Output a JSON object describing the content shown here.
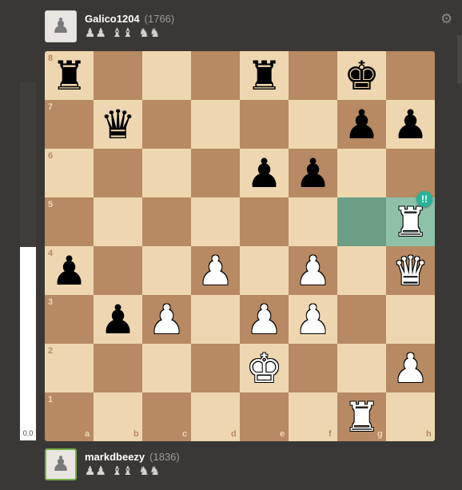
{
  "top_player": {
    "name": "Galico1204",
    "rating": "(1766)",
    "captured": [
      "♟♟",
      "♝♝",
      "♞♞"
    ]
  },
  "bottom_player": {
    "name": "markdbeezy",
    "rating": "(1836)",
    "captured": [
      "♟♟",
      "♝♝",
      "♞♞"
    ]
  },
  "eval": {
    "score": "0.0",
    "white_fraction": 0.54
  },
  "board": {
    "files": [
      "a",
      "b",
      "c",
      "d",
      "e",
      "f",
      "g",
      "h"
    ],
    "ranks": [
      "8",
      "7",
      "6",
      "5",
      "4",
      "3",
      "2",
      "1"
    ],
    "highlights": [
      "g5",
      "h5"
    ],
    "move_badge": {
      "square": "h5",
      "text": "!!",
      "color": "#27b39a"
    },
    "pieces": [
      {
        "sq": "a8",
        "type": "rook",
        "color": "b",
        "glyph": "♜",
        "name": "black-rook-a8"
      },
      {
        "sq": "e8",
        "type": "rook",
        "color": "b",
        "glyph": "♜",
        "name": "black-rook-e8"
      },
      {
        "sq": "g8",
        "type": "king",
        "color": "b",
        "glyph": "♚",
        "name": "black-king-g8"
      },
      {
        "sq": "b7",
        "type": "queen",
        "color": "b",
        "glyph": "♛",
        "name": "black-queen-b7"
      },
      {
        "sq": "g7",
        "type": "pawn",
        "color": "b",
        "glyph": "♟",
        "name": "black-pawn-g7"
      },
      {
        "sq": "h7",
        "type": "pawn",
        "color": "b",
        "glyph": "♟",
        "name": "black-pawn-h7"
      },
      {
        "sq": "e6",
        "type": "pawn",
        "color": "b",
        "glyph": "♟",
        "name": "black-pawn-e6"
      },
      {
        "sq": "f6",
        "type": "pawn",
        "color": "b",
        "glyph": "♟",
        "name": "black-pawn-f6"
      },
      {
        "sq": "h5",
        "type": "rook",
        "color": "w",
        "glyph": "♜",
        "name": "white-rook-h5"
      },
      {
        "sq": "a4",
        "type": "pawn",
        "color": "b",
        "glyph": "♟",
        "name": "black-pawn-a4"
      },
      {
        "sq": "d4",
        "type": "pawn",
        "color": "w",
        "glyph": "♟",
        "name": "white-pawn-d4"
      },
      {
        "sq": "f4",
        "type": "pawn",
        "color": "w",
        "glyph": "♟",
        "name": "white-pawn-f4"
      },
      {
        "sq": "h4",
        "type": "queen",
        "color": "w",
        "glyph": "♛",
        "name": "white-queen-h4"
      },
      {
        "sq": "b3",
        "type": "pawn",
        "color": "b",
        "glyph": "♟",
        "name": "black-pawn-b3"
      },
      {
        "sq": "c3",
        "type": "pawn",
        "color": "w",
        "glyph": "♟",
        "name": "white-pawn-c3"
      },
      {
        "sq": "e3",
        "type": "pawn",
        "color": "w",
        "glyph": "♟",
        "name": "white-pawn-e3"
      },
      {
        "sq": "f3",
        "type": "pawn",
        "color": "w",
        "glyph": "♟",
        "name": "white-pawn-f3"
      },
      {
        "sq": "e2",
        "type": "king",
        "color": "w",
        "glyph": "♚",
        "name": "white-king-e2"
      },
      {
        "sq": "h2",
        "type": "pawn",
        "color": "w",
        "glyph": "♟",
        "name": "white-pawn-h2"
      },
      {
        "sq": "g1",
        "type": "rook",
        "color": "w",
        "glyph": "♜",
        "name": "white-rook-g1"
      }
    ]
  },
  "icons": {
    "settings": "gear-icon",
    "avatar": "pawn-icon"
  }
}
